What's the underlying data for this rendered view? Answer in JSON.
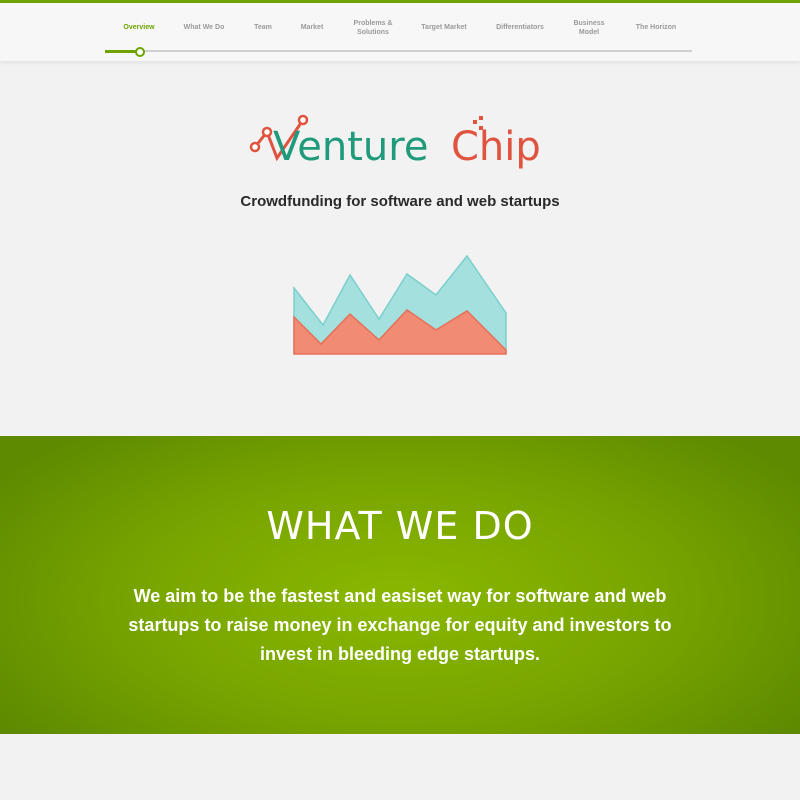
{
  "nav": {
    "items": [
      {
        "label": "Overview",
        "active": true
      },
      {
        "label": "What We Do"
      },
      {
        "label": "Team"
      },
      {
        "label": "Market"
      },
      {
        "label": "Problems & Solutions"
      },
      {
        "label": "Target Market"
      },
      {
        "label": "Differentiators"
      },
      {
        "label": "Business Model"
      },
      {
        "label": "The Horizon"
      }
    ],
    "progress_fraction": 0.06
  },
  "logo": {
    "text_part1": "Venture",
    "text_part2": "Chip",
    "color_primary": "#1f9a7a",
    "color_secondary": "#e0533f"
  },
  "hero": {
    "tagline": "Crowdfunding for software and web startups"
  },
  "section": {
    "title": "WHAT WE DO",
    "text": "We aim to be the fastest and easiset way for software and web startups to raise money in exchange for equity and investors to invest in bleeding edge startups."
  },
  "colors": {
    "accent": "#6ea300",
    "chart_teal": "#a3e0de",
    "chart_red": "#f28b74"
  }
}
